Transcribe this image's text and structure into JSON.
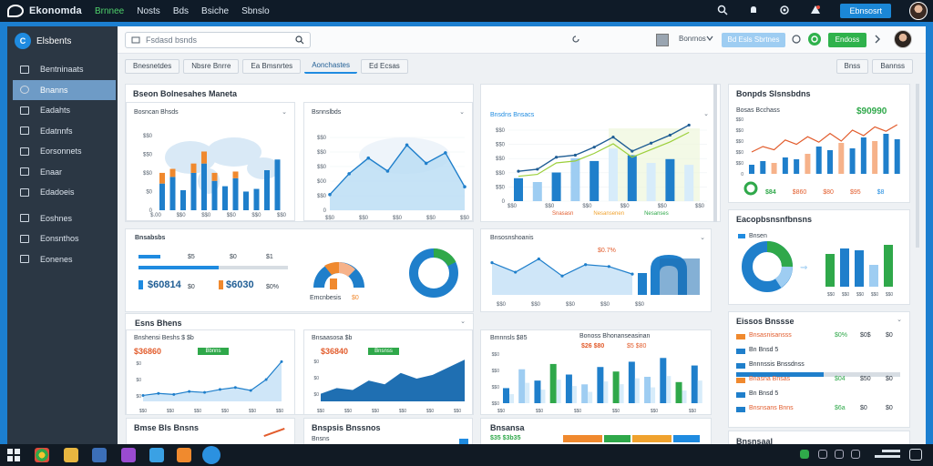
{
  "app": {
    "name": "Ekonomda"
  },
  "topnav": [
    {
      "label": "Brnnee",
      "active": true
    },
    {
      "label": "Nosts",
      "active": false
    },
    {
      "label": "Bds",
      "active": false
    },
    {
      "label": "Bsiche",
      "active": false
    },
    {
      "label": "Sbnslo",
      "active": false
    }
  ],
  "top_button": "Ebnsosrt",
  "sidebar": {
    "title": "Elsbents",
    "badge": "C",
    "items": [
      {
        "label": "Bentninaats",
        "active": false
      },
      {
        "label": "Bnanns",
        "active": true
      },
      {
        "label": "Eadahts",
        "active": false
      },
      {
        "label": "Edatnnfs",
        "active": false
      },
      {
        "label": "Eorsonnets",
        "active": false
      },
      {
        "label": "Enaar",
        "active": false
      },
      {
        "label": "Edadoeis",
        "active": false
      },
      {
        "label": "Eoshnes",
        "active": false
      },
      {
        "label": "Eonsnthos",
        "active": false
      },
      {
        "label": "Eonenes",
        "active": false
      }
    ]
  },
  "header": {
    "search_placeholder": "Fsdasd bsnds",
    "user_label": "Bonrnos",
    "chip_label": "Bd Esls Sbrtnes",
    "action_label": "Endoss"
  },
  "tabs": [
    {
      "label": "Bnesnetdes",
      "active": false
    },
    {
      "label": "Nbsre Bnrre",
      "active": false
    },
    {
      "label": "Ea Bmsnrtes",
      "active": false
    },
    {
      "label": "Aonchastes",
      "active": true
    },
    {
      "label": "Ed Ecsas",
      "active": false
    }
  ],
  "tabs_right": [
    "Bnss",
    "Bannss"
  ],
  "panels": {
    "overview_title": "Bseon Bolnesahes Maneta",
    "map_chart_label": "Bosncan Bhsds",
    "area_chart_label": "Bsnnslbds",
    "combo_chart_label": "Bnsdns Bnsacs",
    "combo_legend": [
      "Snasasn",
      "Nesansenen",
      "Nesanses"
    ],
    "right1_title": "Bonpds Slsnsbdns",
    "right1_label": "Bosas Bcchass",
    "right1_value": "$90990",
    "right1_stats": [
      "$84",
      "$860",
      "$80",
      "$95",
      "$8",
      "$84"
    ],
    "right2_title": "Eacopbsnsnfbnsns",
    "right2_label": "Bnsen",
    "kpi_title": "Bnsabsbs",
    "kpi_values": [
      "$60814",
      "$6030"
    ],
    "kpi_small": [
      "$5",
      "$0",
      "$1",
      "$0"
    ],
    "kpi_pcts": [
      "$0",
      "$0",
      "$0%"
    ],
    "gauge_label": "Emcnbesis",
    "gauge_value": "$0",
    "line2_label": "Bnsosnshoanis",
    "line2_value": "$0.7%",
    "row3_title": "Esns Bhens",
    "row3a_label": "Bnshensi Beshs $ $b",
    "row3a_value": "$36860",
    "row3a_badge": "Bbnns",
    "row3b_label": "Bnsaasosa $b",
    "row3b_value": "$36840",
    "row3b_badge": "Bnsnss",
    "row3c_label": "Bmnnsls $85",
    "row3c_title": "Bonoss Bhonanseasinan",
    "row3c_value": "$26 $80",
    "row3c_value2": "$5 $80",
    "right3_title": "Eissos Bnssse",
    "right3_items": [
      {
        "label": "Bnsasnisansss",
        "v1": "$0%",
        "v2": "$0$",
        "v3": "$0"
      },
      {
        "label": "Bn Bnsd 5",
        "v1": "",
        "v2": "",
        "v3": ""
      },
      {
        "label": "Bnnnssis Bnssdnss",
        "v1": "",
        "v2": "",
        "v3": ""
      },
      {
        "label": "Bnasna Bnsas",
        "v1": "$04",
        "v2": "$50",
        "v3": "$0"
      },
      {
        "label": "Bn Bnsd 5",
        "v1": "",
        "v2": "",
        "v3": ""
      },
      {
        "label": "Bnsnsans Bnns",
        "v1": "$6a",
        "v2": "$0",
        "v3": "$0"
      }
    ],
    "row4a_title": "Bmse Bls Bnsns",
    "row4b_title": "Bnspsis Bnssnos",
    "row4b_sub": "Bnsns",
    "row4c_title": "Bnsansa",
    "row4c_values": "$35 $3b35",
    "row4d_title": "Bnsnsaal"
  },
  "ticks": {
    "y1": [
      "$$0",
      "$$0",
      "$$0",
      "$0",
      "0"
    ],
    "x1": [
      "$.00",
      "$$0",
      "$$0",
      "$$0",
      "$$0",
      "$$0"
    ],
    "y2": [
      "$$0",
      "$$0",
      "$$0",
      "$00",
      "$$0",
      "0"
    ],
    "x2": [
      "$$0",
      "$$0",
      "$$0",
      "$$0",
      "$$0"
    ],
    "y3": [
      "$$0",
      "$$0",
      "$$0",
      "$$0",
      "$$0",
      "0"
    ],
    "x3": [
      "$$0",
      "$$0",
      "$$0",
      "$$0",
      "$$0",
      "$$0"
    ]
  },
  "chart_data": [
    {
      "type": "bar",
      "title": "Bosncan Bhsds",
      "series": [
        {
          "name": "blue",
          "values": [
            20,
            25,
            15,
            28,
            35,
            22,
            18,
            24,
            14,
            16,
            30,
            38
          ]
        },
        {
          "name": "orange",
          "values": [
            8,
            6,
            0,
            7,
            9,
            6,
            0,
            5,
            0,
            0,
            0,
            0
          ]
        }
      ],
      "ylim": [
        0,
        60
      ]
    },
    {
      "type": "area",
      "title": "Bsnnslbds",
      "values": [
        12,
        28,
        40,
        30,
        50,
        36,
        44,
        18
      ],
      "ylim": [
        0,
        60
      ]
    },
    {
      "type": "bar",
      "title": "Bnsdns Bnsacs",
      "series": [
        {
          "name": "bars",
          "values": [
            24,
            20,
            30,
            45,
            42,
            55,
            48,
            40,
            44,
            38
          ]
        },
        {
          "name": "line",
          "values": [
            26,
            28,
            40,
            42,
            50,
            60,
            46,
            54,
            62,
            72
          ]
        }
      ],
      "ylim": [
        0,
        80
      ]
    },
    {
      "type": "area",
      "title": "Bnsosnshoanis",
      "values": [
        34,
        24,
        38,
        20,
        32,
        30,
        22
      ],
      "ylim": [
        0,
        60
      ]
    },
    {
      "type": "bar",
      "title": "Bmnnsls $85",
      "values": [
        20,
        45,
        30,
        52,
        38,
        25,
        48,
        42,
        55,
        35,
        60,
        28,
        50
      ],
      "ylim": [
        0,
        70
      ]
    },
    {
      "type": "pie",
      "title": "Bnsen",
      "values": [
        55,
        30,
        15
      ]
    }
  ]
}
